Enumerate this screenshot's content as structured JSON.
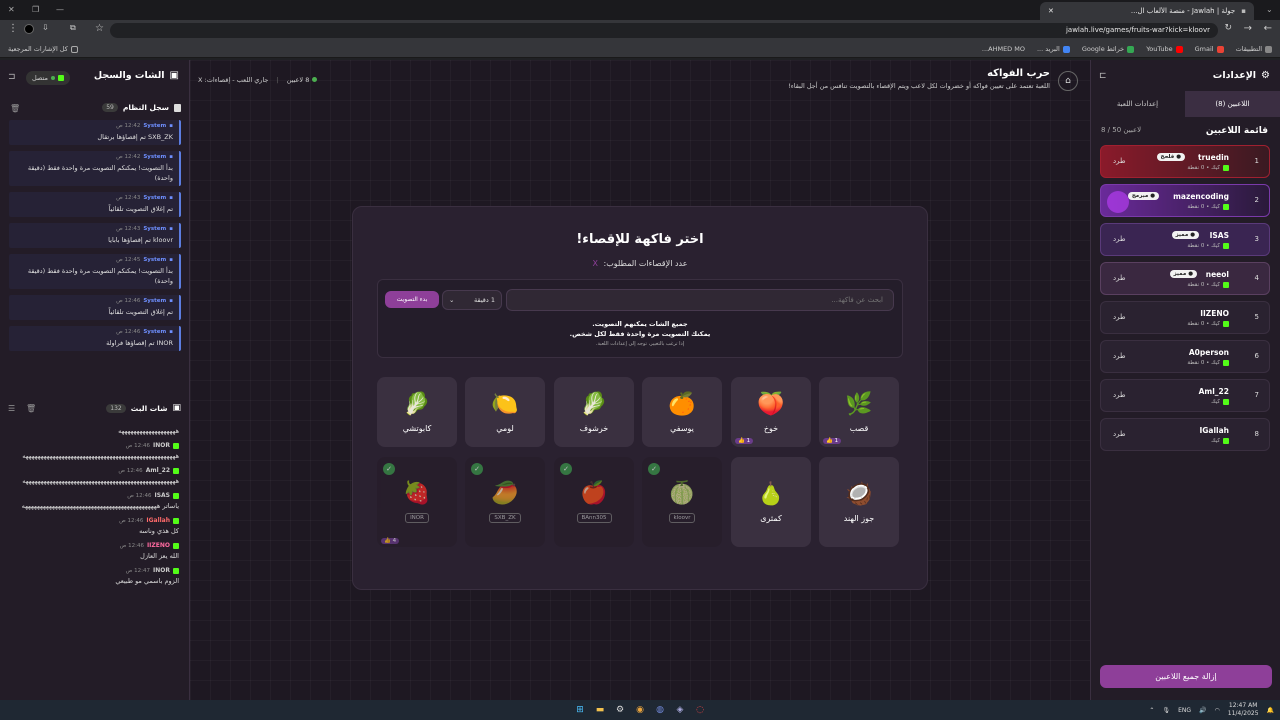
{
  "browser": {
    "tab_title": "جولة | Jawlah - منصة الألعاب ال...",
    "url": "jawlah.live/games/fruits-war?kick=kloovr",
    "bookmarks": [
      "التطبيقات",
      "Gmail",
      "YouTube",
      "خرائط Google",
      "البريد ...",
      "AHMED MO...",
      "كل الإشارات المرجعية"
    ]
  },
  "settings": {
    "title": "الإعدادات",
    "tabs": [
      "اللاعبين (8)",
      "إعدادات اللعبة"
    ],
    "list_title": "قائمة اللاعبين",
    "count": "8 / 50 لاعبين",
    "kick_label": "طرد",
    "remove_all": "إزالة جميع اللاعبين",
    "players": [
      {
        "num": "1",
        "name": "truedin",
        "badge": "● فلحخ",
        "sub": "كيك • 0 نقطة"
      },
      {
        "num": "2",
        "name": "mazencoding",
        "badge": "● مبرمج",
        "sub": "كيك • 0 نقطة"
      },
      {
        "num": "3",
        "name": "ISAS",
        "badge": "● مميز",
        "sub": "كيك • 0 نقطة"
      },
      {
        "num": "4",
        "name": "neeol",
        "badge": "● مميز",
        "sub": "كيك • 0 نقطة"
      },
      {
        "num": "5",
        "name": "IIZENO",
        "badge": "",
        "sub": "كيك • 0 نقطة"
      },
      {
        "num": "6",
        "name": "A0person",
        "badge": "",
        "sub": "كيك • 0 نقطة"
      },
      {
        "num": "7",
        "name": "Aml_22",
        "badge": "",
        "sub": "كيك"
      },
      {
        "num": "8",
        "name": "IGallah",
        "badge": "",
        "sub": "كيك"
      }
    ]
  },
  "chat": {
    "title": "الشات والسجل",
    "connected": "متصل",
    "syslog_title": "سجل النظام",
    "syslog_count": "59",
    "syslog": [
      {
        "sender": "System",
        "time": "12:42 ص",
        "text": "SXB_ZK تم إقصاؤها برتقال"
      },
      {
        "sender": "System",
        "time": "12:42 ص",
        "text": "بدأ التصويت! يمكنكم التصويت مرة واحدة فقط (دقيقة واحدة)"
      },
      {
        "sender": "System",
        "time": "12:43 ص",
        "text": "تم إغلاق التصويت تلقائياً"
      },
      {
        "sender": "System",
        "time": "12:43 ص",
        "text": "kloovr تم إقصاؤها بابايا"
      },
      {
        "sender": "System",
        "time": "12:45 ص",
        "text": "بدأ التصويت! يمكنكم التصويت مرة واحدة فقط (دقيقة واحدة)"
      },
      {
        "sender": "System",
        "time": "12:46 ص",
        "text": "تم إغلاق التصويت تلقائياً"
      },
      {
        "sender": "System",
        "time": "12:46 ص",
        "text": "INOR تم إقصاؤها فراولة"
      }
    ],
    "live_title": "شات البث",
    "live_count": "132",
    "messages": [
      {
        "user": "",
        "time": "",
        "text": "هههههههههههههههههههه"
      },
      {
        "user": "INOR",
        "time": "12:46 ص",
        "text": "هههههههههههههههههههههههههههههههههههههههههههههههههههه"
      },
      {
        "user": "Aml_22",
        "time": "12:46 ص",
        "text": "هههههههههههههههههههههههههههههههههههههههههههههههههههه"
      },
      {
        "user": "ISAS",
        "time": "12:46 ص",
        "text": "ياساتر هههههههههههههههههههههههههههههههههههههههههههههه"
      },
      {
        "user": "IGallah",
        "time": "12:46 ص",
        "text": "كل هذي وناسه"
      },
      {
        "user": "IIZENO",
        "time": "12:46 ص",
        "text": "الله يعز العازل"
      },
      {
        "user": "INOR",
        "time": "12:47 ص",
        "text": "الزوم باسمي مو طبيعي"
      }
    ]
  },
  "game": {
    "title": "حرب الفواكه",
    "desc": "اللعبة تعتمد على تعيين فواكه أو خضروات لكل لاعب ويتم الإقصاء بالتصويت تنافس من أجل البقاء!",
    "players_online": "8 لاعبين",
    "status": "جاري اللعب - إقصاءات: X"
  },
  "card": {
    "title": "اختر فاكهة للإقصاء!",
    "subtitle": "عدد الإقصاءات المطلوب:",
    "sub_x": "X",
    "search_placeholder": "ابحث عن فاكهة...",
    "duration": "1 دقيقة",
    "start_vote": "بدء التصويت",
    "note1": "جميع الشات يمكنهم التصويت.",
    "note2": "يمكنك التصويت مرة واحدة فقط لكل شخص.",
    "note3": "إذا ترغب بالتغيير، توجه إلى إعدادات اللعبة.",
    "fruits": [
      {
        "emoji": "🌿",
        "label": "قصب",
        "votes": "1 👍"
      },
      {
        "emoji": "🍑",
        "label": "خوخ",
        "votes": "1 👍"
      },
      {
        "emoji": "🍊",
        "label": "يوسفي",
        "votes": ""
      },
      {
        "emoji": "🥬",
        "label": "خرشوف",
        "votes": ""
      },
      {
        "emoji": "🍋",
        "label": "لومي",
        "votes": ""
      },
      {
        "emoji": "🥬",
        "label": "كابوتشي",
        "votes": ""
      }
    ],
    "fruits2": [
      {
        "emoji": "🥥",
        "label": "جوز الهند"
      },
      {
        "emoji": "🍐",
        "label": "كمثرى"
      }
    ],
    "eliminated": [
      {
        "emoji": "🍈",
        "label": "kloovr"
      },
      {
        "emoji": "🍎",
        "label": "BAnn305"
      },
      {
        "emoji": "🥭",
        "label": "SXB_ZK"
      },
      {
        "emoji": "🍓",
        "label": "INOR",
        "votes": "4 👍"
      }
    ]
  },
  "taskbar": {
    "lang": "ENG",
    "time": "12:47 AM",
    "date": "11/4/2025"
  }
}
